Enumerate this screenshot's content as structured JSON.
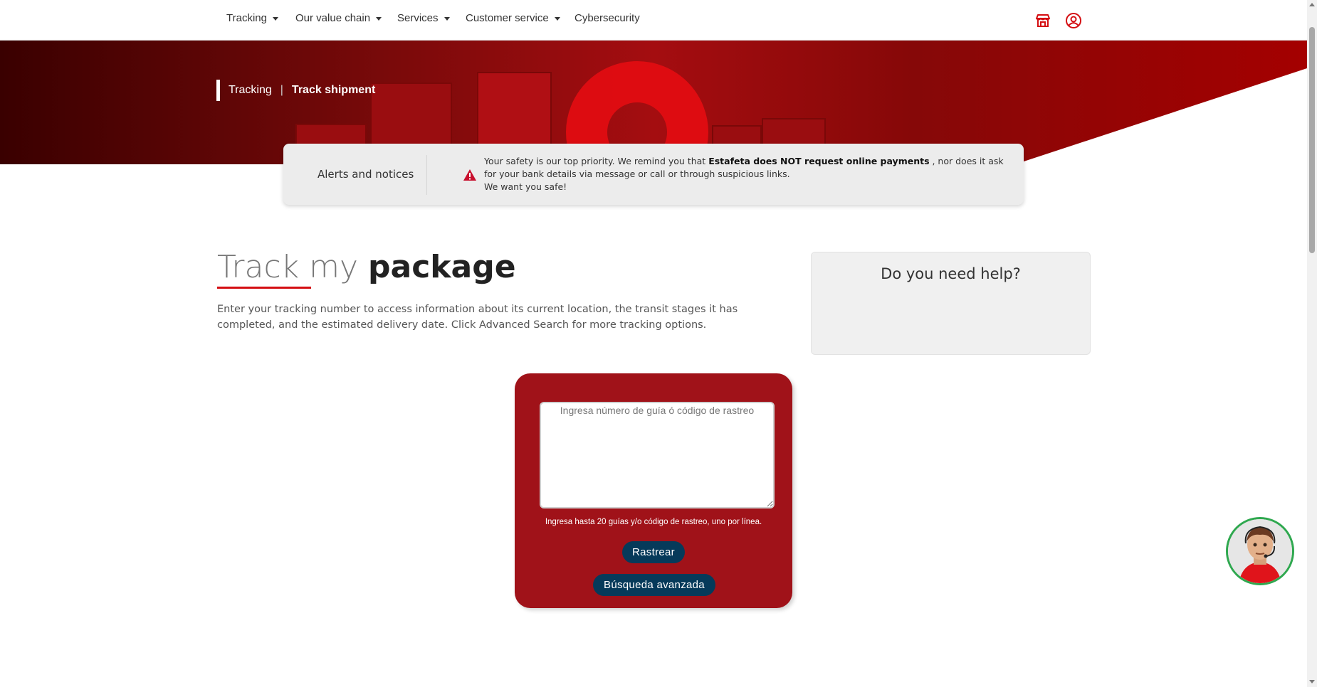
{
  "nav": {
    "items": [
      {
        "label": "Tracking",
        "dropdown": true
      },
      {
        "label": "Our value chain",
        "dropdown": true
      },
      {
        "label": "Services",
        "dropdown": true
      },
      {
        "label": "Customer service",
        "dropdown": true
      },
      {
        "label": "Cybersecurity",
        "dropdown": false
      }
    ],
    "icons": [
      "store-icon",
      "user-account-icon"
    ]
  },
  "breadcrumb": {
    "parent": "Tracking",
    "separator": "|",
    "current": "Track shipment"
  },
  "alert": {
    "title": "Alerts and notices",
    "text_before": "Your safety is our top priority. We remind you that ",
    "text_strong": "Estafeta does NOT request online payments",
    "text_after": " , nor does it ask for your bank details via message or call or through suspicious links.",
    "text_line2": "We want you safe!"
  },
  "main": {
    "title_light": "Track my ",
    "title_bold": "package",
    "intro": "Enter your tracking number to access information about its current location, the transit stages it has completed, and the estimated delivery date. Click Advanced Search for more tracking options."
  },
  "help": {
    "title": "Do you need help?"
  },
  "tracker": {
    "placeholder": "Ingresa número de guía ó código de rastreo",
    "value": "",
    "hint": "Ingresa hasta 20 guías y/o código de rastreo, uno por línea.",
    "track_button": "Rastrear",
    "advanced_button": "Búsqueda avanzada"
  },
  "colors": {
    "brand_red": "#a01219",
    "button_navy": "#063a5a",
    "accent_red": "#d40e12",
    "chatbot_border": "#2fa84f"
  }
}
